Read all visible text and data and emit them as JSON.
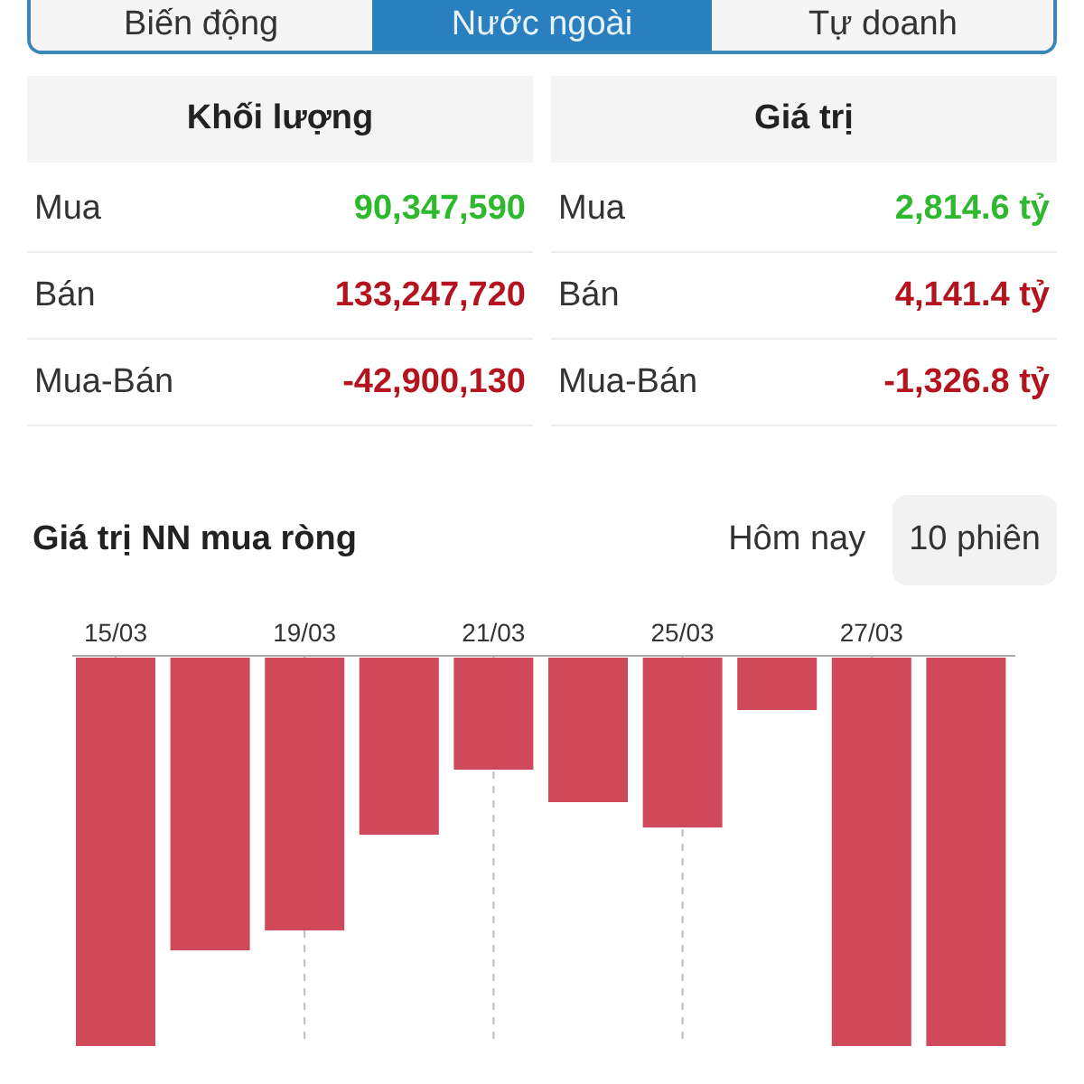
{
  "tabs": [
    {
      "label": "Biến động",
      "selected": false
    },
    {
      "label": "Nước ngoài",
      "selected": true
    },
    {
      "label": "Tự doanh",
      "selected": false
    }
  ],
  "tables": [
    {
      "title": "Khối lượng",
      "rows": [
        {
          "label": "Mua",
          "value": "90,347,590",
          "color": "#2db82d"
        },
        {
          "label": "Bán",
          "value": "133,247,720",
          "color": "#b3141e"
        },
        {
          "label": "Mua-Bán",
          "value": "-42,900,130",
          "color": "#b3141e"
        }
      ]
    },
    {
      "title": "Giá trị",
      "rows": [
        {
          "label": "Mua",
          "value": "2,814.6 tỷ",
          "color": "#2db82d"
        },
        {
          "label": "Bán",
          "value": "4,141.4 tỷ",
          "color": "#b3141e"
        },
        {
          "label": "Mua-Bán",
          "value": "-1,326.8 tỷ",
          "color": "#b3141e"
        }
      ]
    }
  ],
  "net_buy_chart": {
    "title": "Giá trị NN mua ròng",
    "periods": [
      {
        "label": "Hôm nay",
        "selected": false
      },
      {
        "label": "10 phiên",
        "selected": true
      }
    ],
    "date_labels": [
      "15/03",
      "19/03",
      "21/03",
      "25/03",
      "27/03"
    ]
  }
}
